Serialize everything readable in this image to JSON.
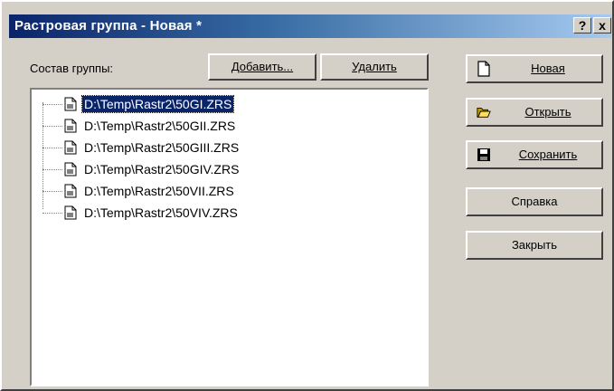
{
  "window": {
    "title": "Растровая группа - Новая *",
    "help_button": "?",
    "close_button": "x"
  },
  "group": {
    "label": "Состав группы:",
    "add_label": "Добавить...",
    "delete_label": "Удалить",
    "files": [
      {
        "path": "D:\\Temp\\Rastr2\\50GI.ZRS",
        "selected": true
      },
      {
        "path": "D:\\Temp\\Rastr2\\50GII.ZRS",
        "selected": false
      },
      {
        "path": "D:\\Temp\\Rastr2\\50GIII.ZRS",
        "selected": false
      },
      {
        "path": "D:\\Temp\\Rastr2\\50GIV.ZRS",
        "selected": false
      },
      {
        "path": "D:\\Temp\\Rastr2\\50VII.ZRS",
        "selected": false
      },
      {
        "path": "D:\\Temp\\Rastr2\\50VIV.ZRS",
        "selected": false
      }
    ]
  },
  "actions": {
    "new_label": "Новая",
    "open_label": "Открыть",
    "save_label": "Сохранить",
    "help_label": "Справка",
    "close_label": "Закрыть"
  },
  "icons": {
    "new": "blank-document-icon",
    "open": "open-folder-icon",
    "save": "floppy-disk-icon",
    "file": "raster-file-icon"
  },
  "colors": {
    "titlebar_start": "#0a246a",
    "titlebar_end": "#a6caf0",
    "selection": "#0a246a",
    "face": "#d4d0c8"
  }
}
